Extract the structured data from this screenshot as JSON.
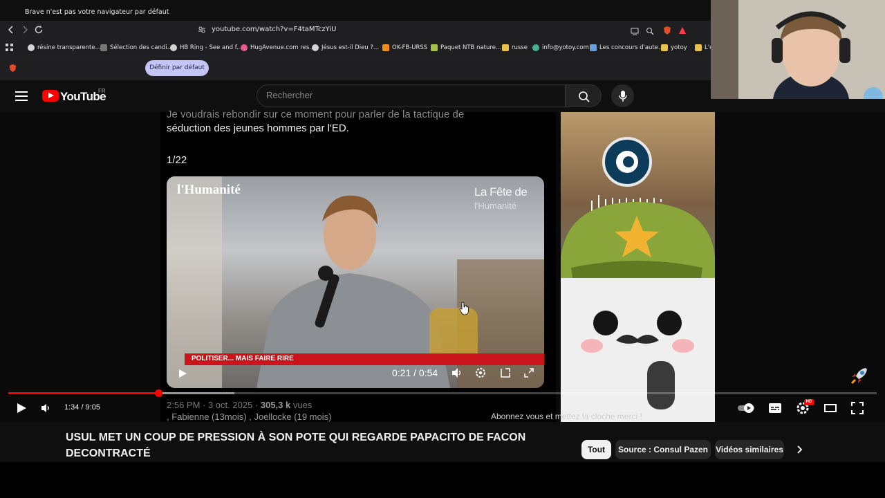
{
  "browser": {
    "url": "youtube.com/watch?v=F4taMTczYiU",
    "bookmarks": [
      "résine transparente...",
      "Sélection des candi...",
      "HB Ring - See and f...",
      "HugAvenue.com res...",
      "Jésus est-il Dieu ?...",
      "OK-FB-URSS",
      "Paquet NTB nature...",
      "russe",
      "info@yotoy.com",
      "Les concours d'aute...",
      "yotoy",
      "L'es"
    ],
    "notification": {
      "text": "Brave n'est pas votre navigateur par défaut",
      "button": "Définir par défaut"
    }
  },
  "youtube": {
    "wordmark": "YouTube",
    "country": "FR",
    "search_placeholder": "Rechercher"
  },
  "video": {
    "tweet_line1": "Je voudrais rebondir sur ce moment pour parler de la tactique de",
    "tweet_line2": "séduction des jeunes hommes par l'ED.",
    "tweet_count": "1/22",
    "embed_logo": "l'Humanité",
    "embed_fete_line1": "La Fête de",
    "embed_fete_line2": "l'Humanité",
    "lower_third": "POLITISER... MAIS FAIRE RIRE",
    "embed_time": "0:21 / 0:54",
    "overlay_date_prefix": "2:56 PM · 3 oct. 2025 · ",
    "overlay_views_value": "305,3 k",
    "overlay_views_suffix": " vues",
    "overlay_members": ", Fabienne (13mois) , Joellocke (19 mois)",
    "avatar_caption": "Abonnez vous et mettez la cloche merci !"
  },
  "player": {
    "time": "1:34 / 9:05",
    "progress_fraction": 0.173,
    "buffer_fraction": 0.26,
    "hd_badge": "HD"
  },
  "title": {
    "text": "USUL MET UN COUP DE PRESSION À SON POTE QUI REGARDE PAPACITO DE FACON DECONTRACTÉ"
  },
  "chips": [
    "Tout",
    "Source : Consul Pazen",
    "Vidéos similaires"
  ],
  "colors": {
    "accent_red": "#ff0000",
    "lower_third_red": "#c9141c",
    "notif_button": "#c2c5f5"
  }
}
